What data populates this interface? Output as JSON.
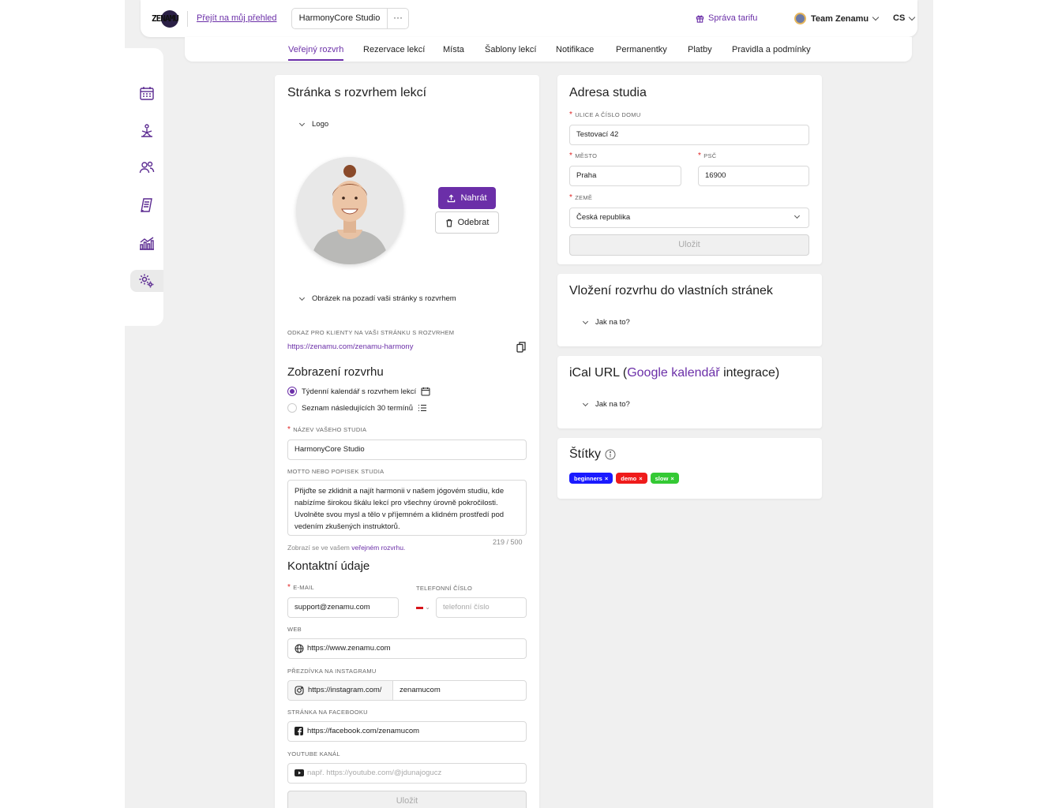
{
  "header": {
    "logo_text": "ZENAMU",
    "overview_link": "Přejít na můj přehled",
    "studio_name": "HarmonyCore Studio",
    "more": "···",
    "plan_link": "Správa tarifu",
    "team_name": "Team Zenamu",
    "language": "CS"
  },
  "tabs": [
    {
      "label": "Veřejný rozvrh",
      "active": true
    },
    {
      "label": "Rezervace lekcí"
    },
    {
      "label": "Místa"
    },
    {
      "label": "Šablony lekcí"
    },
    {
      "label": "Notifikace"
    },
    {
      "label": "Permanentky"
    },
    {
      "label": "Platby"
    },
    {
      "label": "Pravidla a podmínky"
    }
  ],
  "sidebar": {
    "items": [
      "calendar-icon",
      "yoga-icon",
      "users-icon",
      "receipt-icon",
      "analytics-icon",
      "settings-icon"
    ]
  },
  "schedule_page": {
    "title": "Stránka s rozvrhem lekcí",
    "logo_section": "Logo",
    "upload_label": "Nahrát",
    "remove_label": "Odebrat",
    "background_section": "Obrázek na pozadí vaši stránky s rozvrhem",
    "link_label": "Odkaz pro klienty na vaši stránku s rozvrhem",
    "link_url": "https://zenamu.com/zenamu-harmony",
    "display_title": "Zobrazení rozvrhu",
    "display_option_1": "Týdenní kalendář s rozvrhem lekcí",
    "display_option_2": "Seznam následujících 30 termínů",
    "studio_name_label": "Název vašeho studia",
    "studio_name_value": "HarmonyCore Studio",
    "motto_label": "Motto nebo popisek studia",
    "motto_value": "Přijďte se zklidnit a najít harmonii v našem jógovém studiu, kde nabízíme širokou škálu lekcí pro všechny úrovně pokročilosti. Uvolněte svou mysl a tělo v příjemném a klidném prostředí pod vedením zkušených instruktorů.",
    "motto_counter": "219 / 500",
    "motto_hint_prefix": "Zobrazí se ve vašem",
    "motto_hint_link": "veřejném rozvrhu.",
    "contact_title": "Kontaktní údaje",
    "email_label": "E-mail",
    "email_value": "support@zenamu.com",
    "phone_label": "Telefonní číslo",
    "phone_placeholder": "telefonní číslo",
    "web_label": "Web",
    "web_value": "https://www.zenamu.com",
    "instagram_label": "Přezdívka na Instagramu",
    "instagram_prefix": "https://instagram.com/",
    "instagram_value": "zenamucom",
    "facebook_label": "Stránka na Facebooku",
    "facebook_value": "https://facebook.com/zenamucom",
    "youtube_label": "YouTube kanál",
    "youtube_placeholder": "např. https://youtube.com/@jdunajogucz",
    "save_label": "Uložit"
  },
  "address": {
    "title": "Adresa studia",
    "street_label": "Ulice a číslo domu",
    "street_value": "Testovací 42",
    "city_label": "Město",
    "city_value": "Praha",
    "zip_label": "PSČ",
    "zip_value": "16900",
    "country_label": "Země",
    "country_value": "Česká republika",
    "save_label": "Uložit"
  },
  "embed": {
    "title": "Vložení rozvrhu do vlastních stránek",
    "howto": "Jak na to?"
  },
  "ical": {
    "title_prefix": "iCal URL (",
    "title_link": "Google kalendář",
    "title_suffix": " integrace)",
    "howto": "Jak na to?"
  },
  "tags": {
    "title": "Štítky",
    "items": [
      {
        "label": "beginners",
        "color": "#1a1aff"
      },
      {
        "label": "demo",
        "color": "#ef1b1b"
      },
      {
        "label": "slow",
        "color": "#34c934"
      }
    ]
  },
  "colors": {
    "accent": "#6b2fa8",
    "required": "#e02424"
  }
}
